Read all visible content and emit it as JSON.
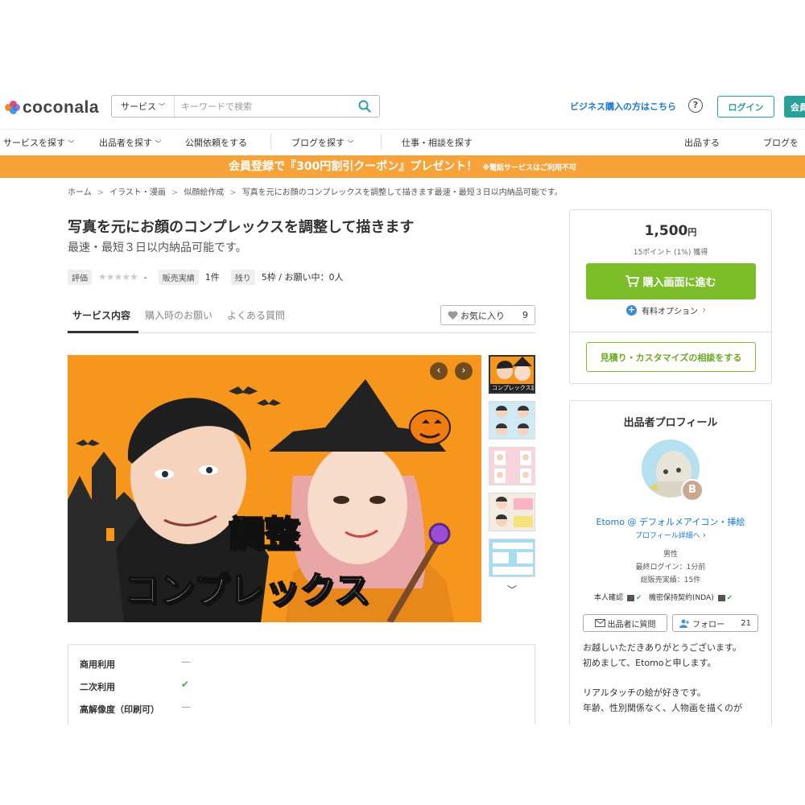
{
  "header": {
    "logo_text": "coconala",
    "search_category": "サービス",
    "search_placeholder": "キーワードで検索",
    "business_link": "ビジネス購入の方はこちら",
    "help": "?",
    "login": "ログイン",
    "register": "会員"
  },
  "nav": {
    "items": [
      "サービスを探す",
      "出品者を探す",
      "公開依頼をする",
      "ブログを探す",
      "仕事・相談を探す",
      "出品する",
      "ブログを"
    ]
  },
  "banner": {
    "text": "会員登録で『300円割引クーポン』プレゼント！",
    "note": "※電話サービスはご利用不可"
  },
  "breadcrumb": [
    "ホーム",
    "イラスト・漫画",
    "似顔絵作成",
    "写真を元にお顔のコンプレックスを調整して描きます最速・最短３日以内納品可能です。"
  ],
  "service": {
    "title": "写真を元にお顔のコンプレックスを調整して描きます",
    "subtitle": "最速・最短３日以内納品可能です。",
    "rating_label": "評価",
    "rating_value": "-",
    "sales_label": "販売実績",
    "sales_value": "1件",
    "remaining_label": "残り",
    "remaining_value": "5枠 / お願い中：0人"
  },
  "tabs": {
    "items": [
      "サービス内容",
      "購入時のお願い",
      "よくある質問"
    ],
    "favorite_label": "お気に入り",
    "favorite_count": "9"
  },
  "image": {
    "caption_line1": "調整",
    "caption_line2": "コンプレックス",
    "thumb1_caption": "コンプレックス調整"
  },
  "details": {
    "rows": [
      {
        "label": "商用利用",
        "value": "—"
      },
      {
        "label": "二次利用",
        "value": "✔"
      },
      {
        "label": "高解像度（印刷可）",
        "value": "—"
      }
    ]
  },
  "purchase": {
    "price": "1,500",
    "currency": "円",
    "points": "15ポイント (1%) 獲得",
    "buy_button": "購入画面に進む",
    "option": "有料オプション",
    "consult_button": "見積り・カスタマイズの相談をする"
  },
  "seller": {
    "title": "出品者プロフィール",
    "rank": "B",
    "name": "Etomo @ デフォルメアイコン・挿絵",
    "profile_link": "プロフィール詳細へ",
    "gender": "男性",
    "last_login": "最終ログイン：1分前",
    "total_sales": "総販売実績：15件",
    "identity": "本人確認",
    "nda": "機密保持契約(NDA)",
    "message_button": "出品者に質問",
    "follow_button": "フォロー",
    "follow_count": "21",
    "bio": [
      "お越しいただきありがとうございます。",
      "初めまして、Etomoと申します。",
      "リアルタッチの絵が好きです。",
      "年齢、性別関係なく、人物画を描くのが"
    ]
  },
  "colors": {
    "accent_teal": "#2aa198",
    "banner_orange": "#f8a33a",
    "buy_green": "#7cbd2a",
    "link_blue": "#1778d4"
  }
}
